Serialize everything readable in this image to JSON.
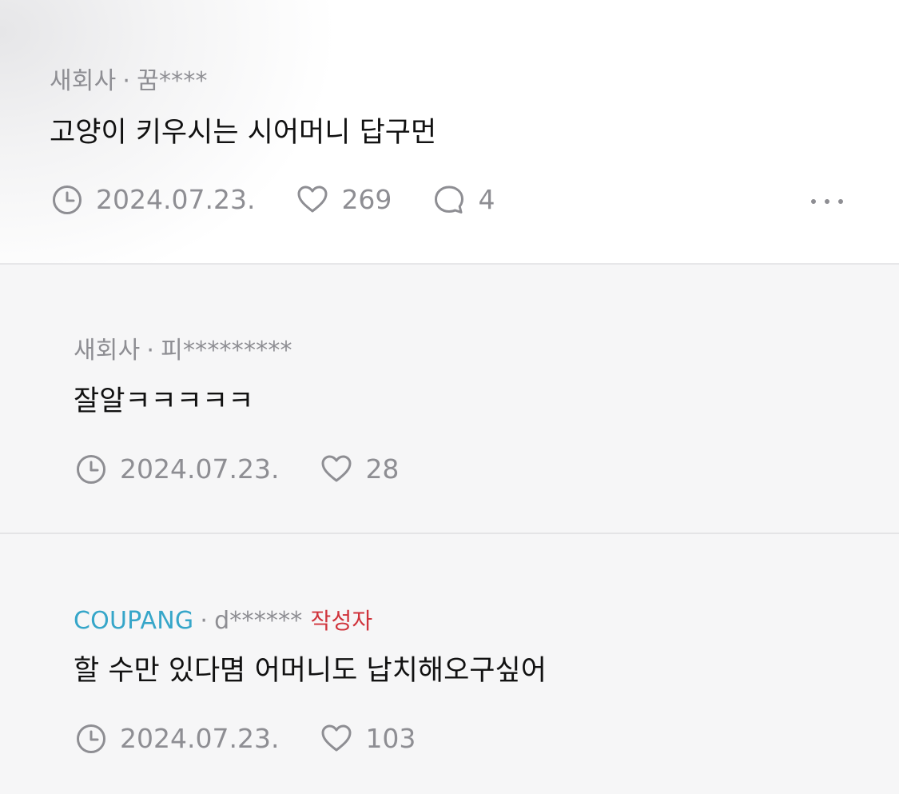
{
  "comments": [
    {
      "company": "새회사",
      "separator": "·",
      "author": "꿈****",
      "text": "고양이 키우시는 시어머니 답구먼",
      "date": "2024.07.23.",
      "likes": "269",
      "replies": "4"
    },
    {
      "company": "새회사",
      "separator": "·",
      "author": "피*********",
      "text": "잘알ㅋㅋㅋㅋㅋ",
      "date": "2024.07.23.",
      "likes": "28"
    },
    {
      "company": "COUPANG",
      "separator": "·",
      "author": "d******",
      "author_badge": "작성자",
      "text": "할 수만 있다몀 어머니도 납치해오구싶어",
      "date": "2024.07.23.",
      "likes": "103"
    }
  ],
  "icons": {
    "clock": "clock-icon",
    "heart": "heart-icon",
    "comment": "comment-bubble-icon",
    "more": "more-dots-icon"
  },
  "colors": {
    "meta_gray": "#8e8e93",
    "company_link": "#36a6c9",
    "author_badge": "#d0333b",
    "text": "#111111"
  }
}
